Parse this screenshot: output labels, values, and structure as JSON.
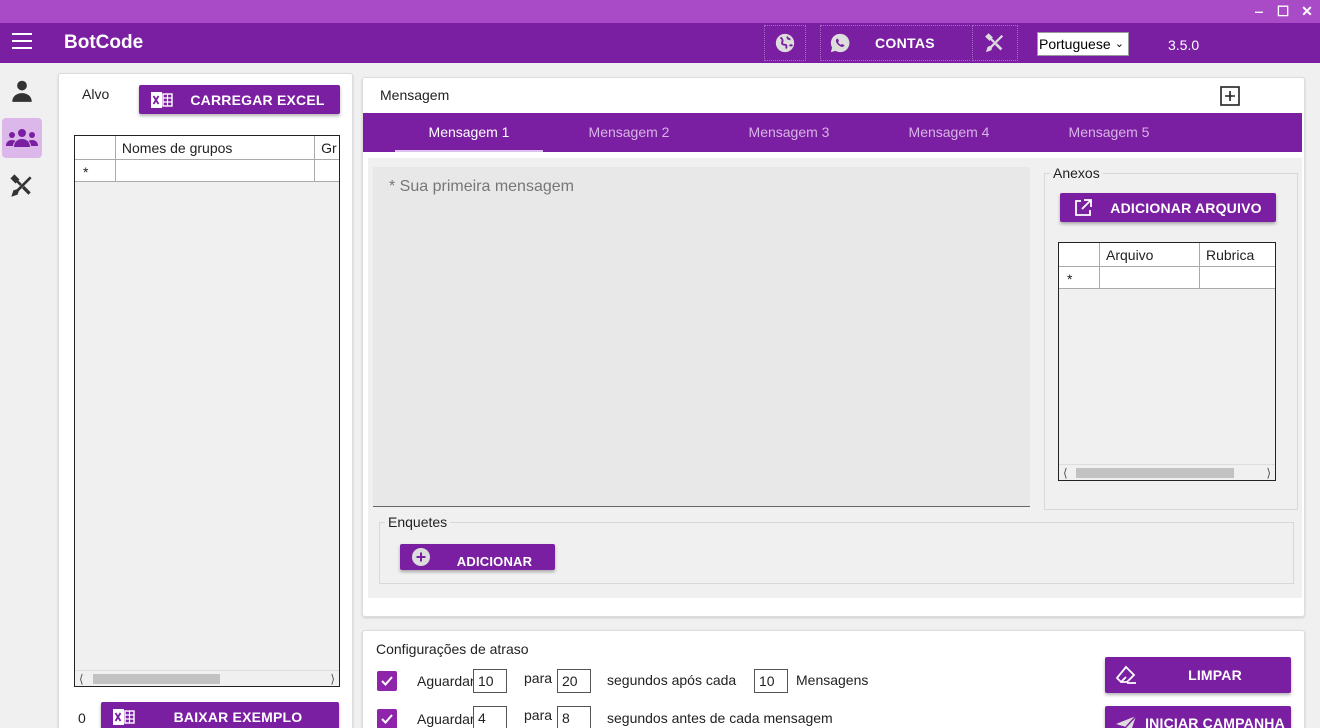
{
  "window": {
    "minimize": "‒",
    "maximize": "☐",
    "close": "✕"
  },
  "appbar": {
    "title": "BotCode",
    "contas_label": "CONTAS",
    "language": "Portuguese",
    "version": "3.5.0",
    "icons": [
      "menu-icon",
      "globe-icon",
      "whatsapp-icon",
      "tools-icon"
    ]
  },
  "sidebar": {
    "items": [
      {
        "icon": "person-icon",
        "active": false
      },
      {
        "icon": "group-icon",
        "active": true
      },
      {
        "icon": "tools-icon",
        "active": false
      }
    ]
  },
  "alvo": {
    "label": "Alvo",
    "load_excel": "CARREGAR EXCEL",
    "columns": [
      "Nomes de grupos",
      "Gr"
    ],
    "new_row_marker": "*",
    "count": "0",
    "download_example": "BAIXAR EXEMPLO"
  },
  "mensagem": {
    "label": "Mensagem",
    "tabs": [
      "Mensagem 1",
      "Mensagem 2",
      "Mensagem 3",
      "Mensagem 4",
      "Mensagem 5"
    ],
    "active_tab": 0,
    "placeholder": "* Sua primeira mensagem",
    "anexos": {
      "label": "Anexos",
      "add_file": "ADICIONAR ARQUIVO",
      "columns": [
        "Arquivo",
        "Rubrica"
      ],
      "new_row_marker": "*"
    },
    "enquetes": {
      "label": "Enquetes",
      "add_poll": "ADICIONAR ENQUETE"
    }
  },
  "atraso": {
    "label": "Configurações de atraso",
    "rows": [
      {
        "checked": true,
        "wait_label": "Aguardar",
        "from": "10",
        "to_label": "para",
        "to": "20",
        "suffix": "segundos após cada",
        "count": "10",
        "count_label": "Mensagens"
      },
      {
        "checked": true,
        "wait_label": "Aguardar",
        "from": "4",
        "to_label": "para",
        "to": "8",
        "suffix": "segundos antes de cada mensagem"
      }
    ],
    "clear": "LIMPAR",
    "start": "INICIAR CAMPANHA"
  },
  "colors": {
    "primary": "#7b1fa2",
    "titlebar": "#a94bc6",
    "nav_active": "#dcb8ea"
  }
}
